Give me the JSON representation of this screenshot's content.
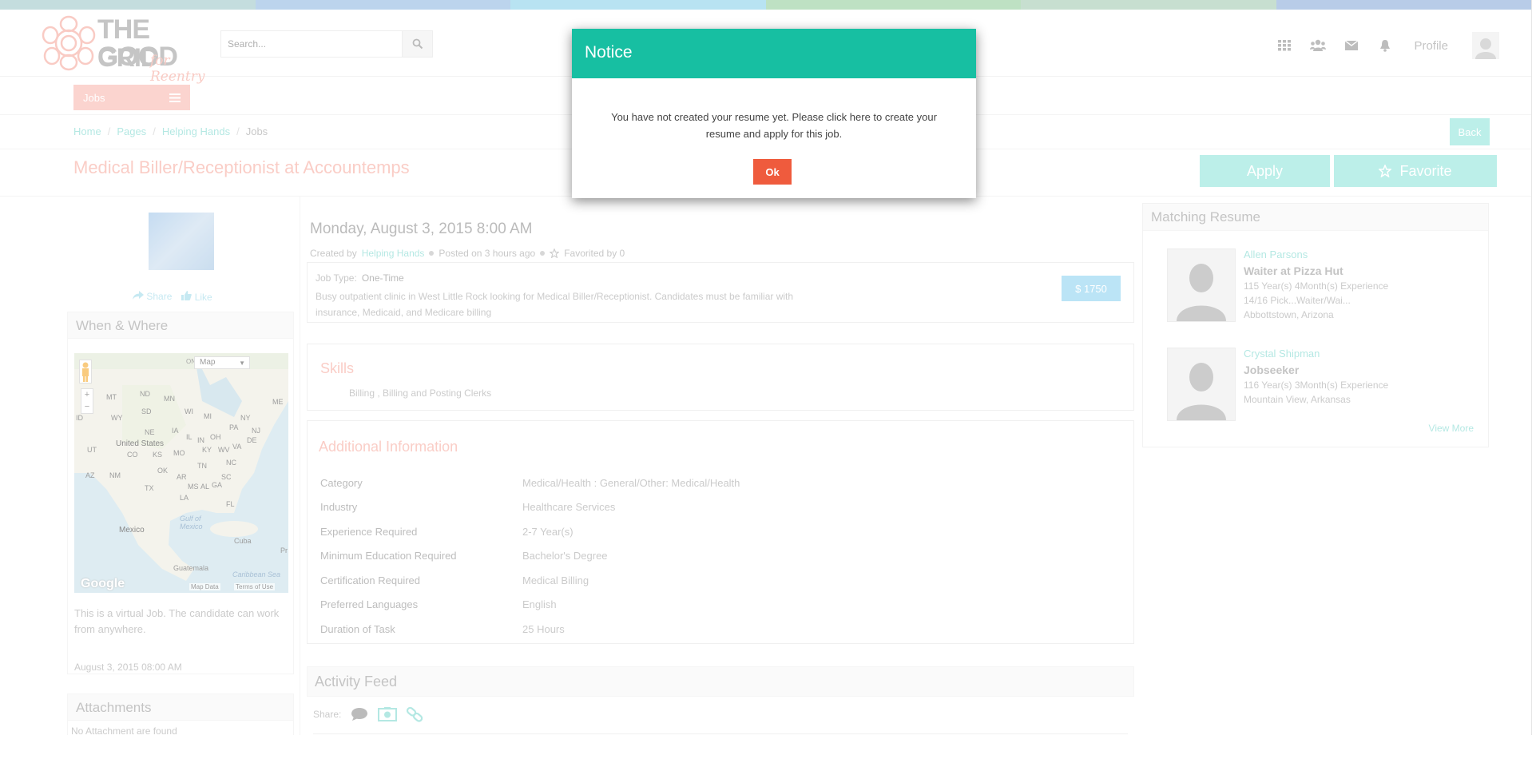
{
  "colors": {
    "accent_teal": "#17bfa2",
    "light_teal": "#8ce3d9",
    "salmon": "#f7a99e",
    "ok_red": "#ef5b3d",
    "price_blue": "#8bd0ef",
    "stripe": [
      "#9ac4c6",
      "#8cb6e0",
      "#86cfe8",
      "#8fcc98",
      "#9fc8ae",
      "#86a8d8"
    ]
  },
  "header": {
    "logo_line1": "THE GOOD",
    "logo_line2": "GRID",
    "logo_script": "for Reentry",
    "search_placeholder": "Search...",
    "profile_label": "Profile",
    "icons": [
      "grid-icon",
      "users-icon",
      "mail-icon",
      "bell-icon"
    ]
  },
  "nav": {
    "jobs_label": "Jobs"
  },
  "breadcrumb": {
    "items": [
      "Home",
      "Pages",
      "Helping Hands"
    ],
    "current": "Jobs",
    "separator": "/",
    "back_label": "Back"
  },
  "job": {
    "title": "Medical Biller/Receptionist at Accountemps",
    "apply_label": "Apply",
    "favorite_label": "Favorite",
    "date": "Monday, August 3, 2015 8:00 AM",
    "created_by_label": "Created by",
    "created_by": "Helping Hands",
    "posted": "Posted on 3 hours ago",
    "favorited": "Favorited by 0",
    "job_type_label": "Job Type:",
    "job_type": "One-Time",
    "description": "Busy outpatient clinic in West Little Rock looking for Medical Biller/Receptionist. Candidates must be familiar with insurance, Medicaid, and Medicare billing",
    "price": "$ 1750",
    "skills_title": "Skills",
    "skills": "Billing ,  Billing and Posting Clerks",
    "additional_title": "Additional Information",
    "info": [
      {
        "key": "Category",
        "value": "Medical/Health :  General/Other: Medical/Health"
      },
      {
        "key": "Industry",
        "value": "Healthcare Services"
      },
      {
        "key": "Experience Required",
        "value": "2-7   Year(s)"
      },
      {
        "key": "Minimum Education Required",
        "value": "Bachelor's Degree"
      },
      {
        "key": "Certification Required",
        "value": "Medical Billing"
      },
      {
        "key": "Preferred Languages",
        "value": "English"
      },
      {
        "key": "Duration of Task",
        "value": "25 Hours"
      }
    ],
    "activity_title": "Activity Feed",
    "share_label": "Share:"
  },
  "left": {
    "share_label": "Share",
    "like_label": "Like",
    "when_where_title": "When & Where",
    "map": {
      "type_label": "Map",
      "on_label": "ON",
      "zoom_in": "+",
      "zoom_out": "−",
      "google": "Google",
      "map_data": "Map Data",
      "terms": "Terms of Use",
      "labels": [
        "United States",
        "Mexico",
        "Gulf of Mexico",
        "Cuba",
        "Guatemala",
        "Caribbean Sea",
        "ND",
        "MN",
        "MT",
        "SD",
        "WI",
        "MI",
        "WY",
        "NE",
        "IA",
        "IL",
        "OH",
        "PA",
        "NY",
        "UT",
        "CO",
        "KS",
        "MO",
        "KY",
        "WV",
        "VA",
        "OK",
        "TN",
        "NC",
        "AZ",
        "NM",
        "AR",
        "SC",
        "MS",
        "AL",
        "GA",
        "TX",
        "LA",
        "FL",
        "IN",
        "NJ",
        "DE",
        "ID",
        "ME",
        "Pr"
      ]
    },
    "virtual_text": "This is a virtual Job. The candidate can work from anywhere.",
    "date": "August 3, 2015 08:00 AM",
    "attachments_title": "Attachments",
    "no_attachments": "No Attachment are found"
  },
  "right": {
    "title": "Matching Resume",
    "resumes": [
      {
        "name": "Allen Parsons",
        "title": "Waiter at Pizza Hut",
        "experience": "115 Year(s) 4Month(s) Experience",
        "line2": "14/16 Pick...Waiter/Wai...",
        "location": "Abbottstown, Arizona"
      },
      {
        "name": "Crystal Shipman",
        "title": "Jobseeker",
        "experience": "116 Year(s) 3Month(s) Experience",
        "location": "Mountain View, Arkansas"
      }
    ],
    "view_more": "View More"
  },
  "modal": {
    "title": "Notice",
    "message": "You have not created your resume yet. Please click here to create your resume and apply for this job.",
    "ok_label": "Ok"
  }
}
